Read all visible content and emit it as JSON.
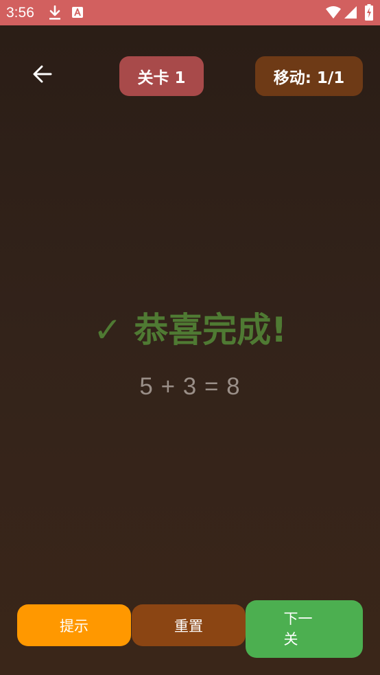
{
  "status_bar": {
    "time": "3:56",
    "color": "#d2605f",
    "icons": [
      "download-icon",
      "a-notification-icon",
      "wifi-icon",
      "signal-icon",
      "battery-charging-icon"
    ]
  },
  "header": {
    "back_icon": "arrow-left-icon",
    "level_label": "关卡 1",
    "moves_label": "移动: 1/1",
    "level_color": "#a84a4a",
    "moves_color": "#6e3a16"
  },
  "main": {
    "success_text": "✓ 恭喜完成!",
    "success_color": "#4f7a33",
    "equation": "5 + 3 = 8",
    "equation_color": "#9a8f88"
  },
  "actions": {
    "hint_label": "提示",
    "reset_label": "重置",
    "next_label": "下一关",
    "hint_color": "#ff9800",
    "reset_color": "#8b4513",
    "next_color": "#4caf50"
  }
}
